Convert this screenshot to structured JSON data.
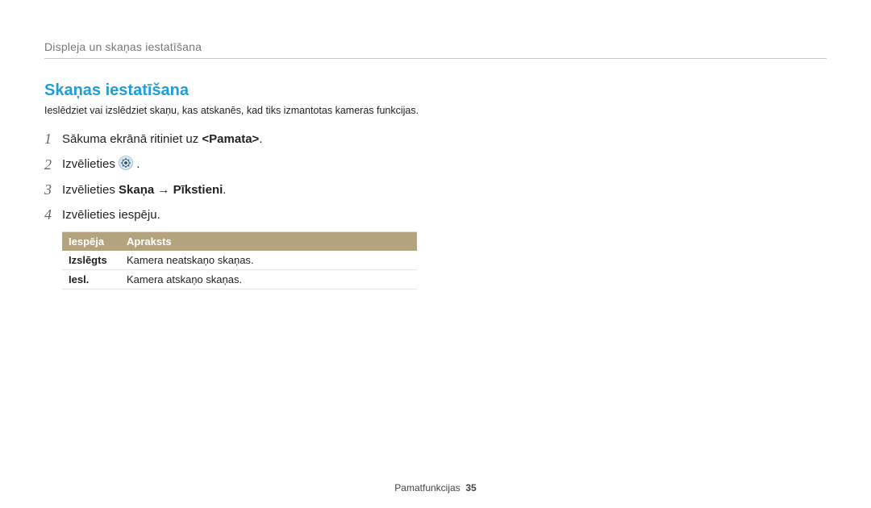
{
  "header": {
    "breadcrumb": "Displeja un skaņas iestatīšana"
  },
  "section": {
    "heading": "Skaņas iestatīšana",
    "desc": "Ieslēdziet vai izslēdziet skaņu, kas atskanēs, kad tiks izmantotas kameras funkcijas."
  },
  "steps": [
    {
      "num": "1",
      "prefix": "Sākuma ekrānā ritiniet uz ",
      "bold": "<Pamata>",
      "suffix": "."
    },
    {
      "num": "2",
      "prefix": "Izvēlieties ",
      "icon": true,
      "suffix": " ."
    },
    {
      "num": "3",
      "prefix": "Izvēlieties ",
      "bold": "Skaņa",
      "arrow": " → ",
      "bold2": "Pīkstieni",
      "suffix": "."
    },
    {
      "num": "4",
      "prefix": "Izvēlieties iespēju."
    }
  ],
  "table": {
    "head": {
      "c1": "Iespēja",
      "c2": "Apraksts"
    },
    "rows": [
      {
        "c1": "Izslēgts",
        "c2": "Kamera neatskaņo skaņas."
      },
      {
        "c1": "Iesl.",
        "c2": "Kamera atskaņo skaņas."
      }
    ]
  },
  "footer": {
    "label": "Pamatfunkcijas",
    "page": "35"
  }
}
